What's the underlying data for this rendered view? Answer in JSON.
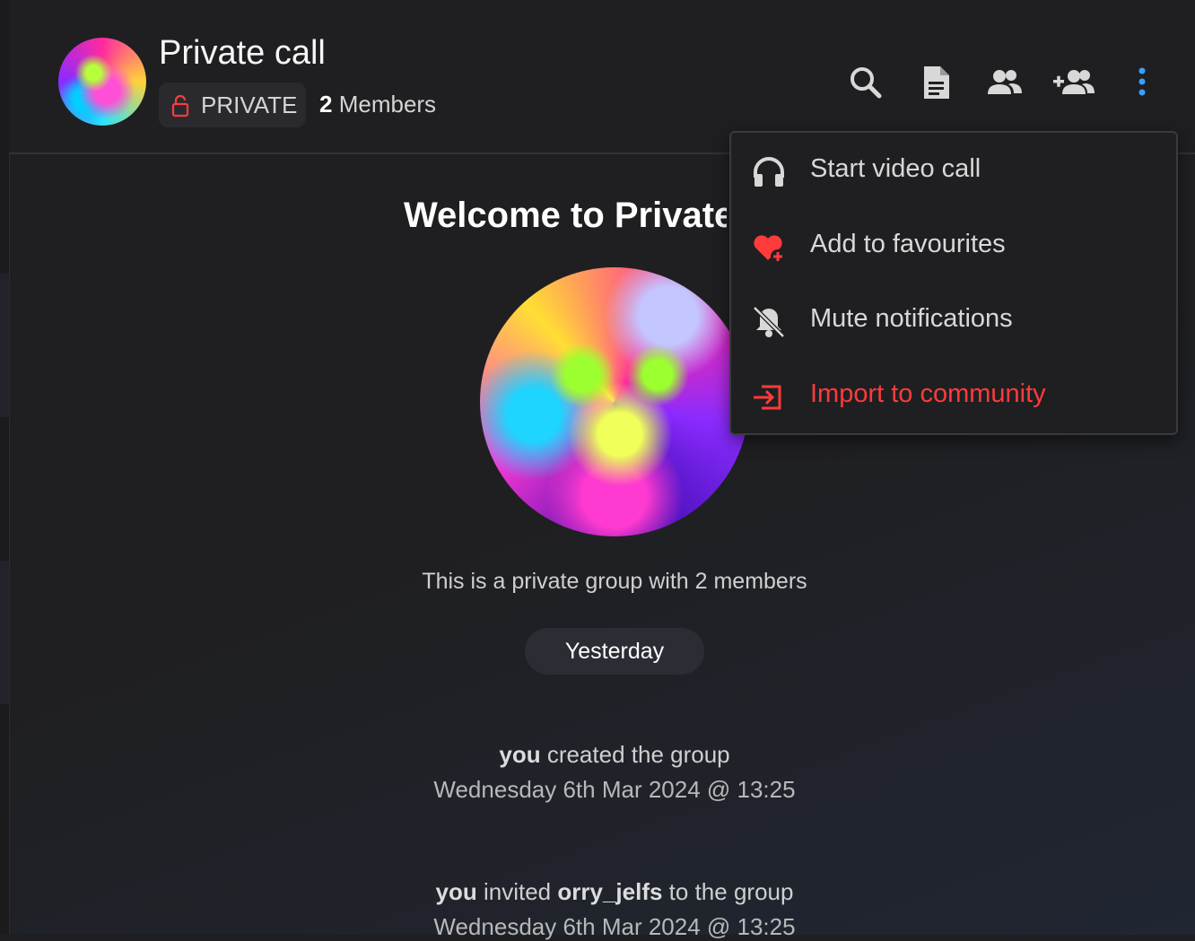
{
  "header": {
    "title": "Private call",
    "privacy_label": "PRIVATE",
    "member_count": "2",
    "member_label": "Members",
    "icons": [
      "search-icon",
      "document-icon",
      "members-icon",
      "add-member-icon",
      "more-vert-icon"
    ]
  },
  "welcome": {
    "title": "Welcome to Private",
    "subtitle": "This is a private group with 2 members"
  },
  "date_divider": "Yesterday",
  "events": [
    {
      "actor": "you",
      "text": " created the group",
      "timestamp": "Wednesday 6th Mar 2024 @ 13:25"
    },
    {
      "actor": "you",
      "text_before": " invited ",
      "target": "orry_jelfs",
      "text_after": " to the group",
      "timestamp": "Wednesday 6th Mar 2024 @ 13:25"
    }
  ],
  "menu": {
    "items": [
      {
        "label": "Start video call",
        "icon": "headphones-icon"
      },
      {
        "label": "Add to favourites",
        "icon": "heart-plus-icon"
      },
      {
        "label": "Mute notifications",
        "icon": "bell-off-icon"
      },
      {
        "label": "Import to community",
        "icon": "import-icon"
      }
    ]
  },
  "colors": {
    "accent_blue": "#3aa0ff",
    "danger_red": "#ff3b3b",
    "background": "#1f1f22"
  }
}
